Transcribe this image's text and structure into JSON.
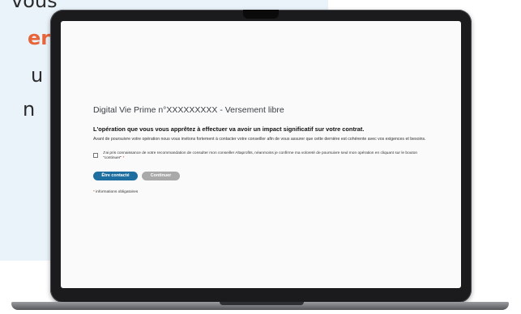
{
  "background": {
    "lines": [
      "vous",
      "er",
      "u",
      "n"
    ],
    "accent_color": "#e8653a"
  },
  "page": {
    "title": "Digital Vie Prime n°XXXXXXXXX - Versement libre",
    "impact_heading": "L'opération que vous vous apprêtez à effectuer va avoir un impact significatif sur votre contrat.",
    "intro": "Avant de poursuivre votre opération nous vous invitons fortement à contacter votre conseiller afin de vous assurer que cette dernière est cohérente avec vos exigences et besoins.",
    "checkbox_label": "J'ai pris connaissance de votre recommandation de consulter mon conseiller Altaprofits, néanmoins je confirme ma voloreté de poursuivre seul mon opération en cliquant sur le bouton \"continuer\"",
    "required_star": "*",
    "checkbox_checked": false,
    "buttons": {
      "contact": "Être contacté",
      "continue": "Continuer"
    },
    "required_note": "informations obligatoires"
  },
  "colors": {
    "primary_button": "#1e6f9f",
    "disabled_button": "#a9a9a9",
    "required": "#d62c2c"
  }
}
